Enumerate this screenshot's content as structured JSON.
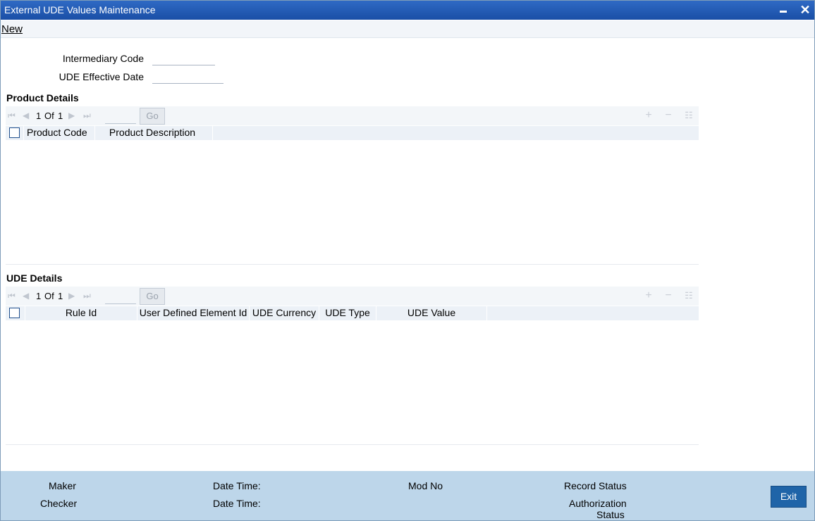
{
  "window": {
    "title": "External UDE Values Maintenance"
  },
  "menu": {
    "new_label": "New"
  },
  "form": {
    "intermediary_code_label": "Intermediary Code",
    "intermediary_code_value": "",
    "ude_effective_date_label": "UDE Effective Date",
    "ude_effective_date_value": ""
  },
  "product_details": {
    "title": "Product Details",
    "pager": {
      "current": "1",
      "of_label": "Of",
      "total": "1",
      "go_label": "Go"
    },
    "columns": [
      "Product Code",
      "Product Description"
    ]
  },
  "ude_details": {
    "title": "UDE Details",
    "pager": {
      "current": "1",
      "of_label": "Of",
      "total": "1",
      "go_label": "Go"
    },
    "columns": [
      "Rule Id",
      "User Defined Element Id",
      "UDE Currency",
      "UDE Type",
      "UDE Value"
    ]
  },
  "footer": {
    "maker_label": "Maker",
    "checker_label": "Checker",
    "date_time_label_1": "Date Time:",
    "date_time_label_2": "Date Time:",
    "mod_no_label": "Mod No",
    "record_status_label": "Record Status",
    "authorization_label": "Authorization",
    "status_label": "Status",
    "exit_label": "Exit"
  },
  "colors": {
    "titlebar": "#1e56b0",
    "footer": "#bdd6ea",
    "exit_button": "#1f64a8"
  }
}
